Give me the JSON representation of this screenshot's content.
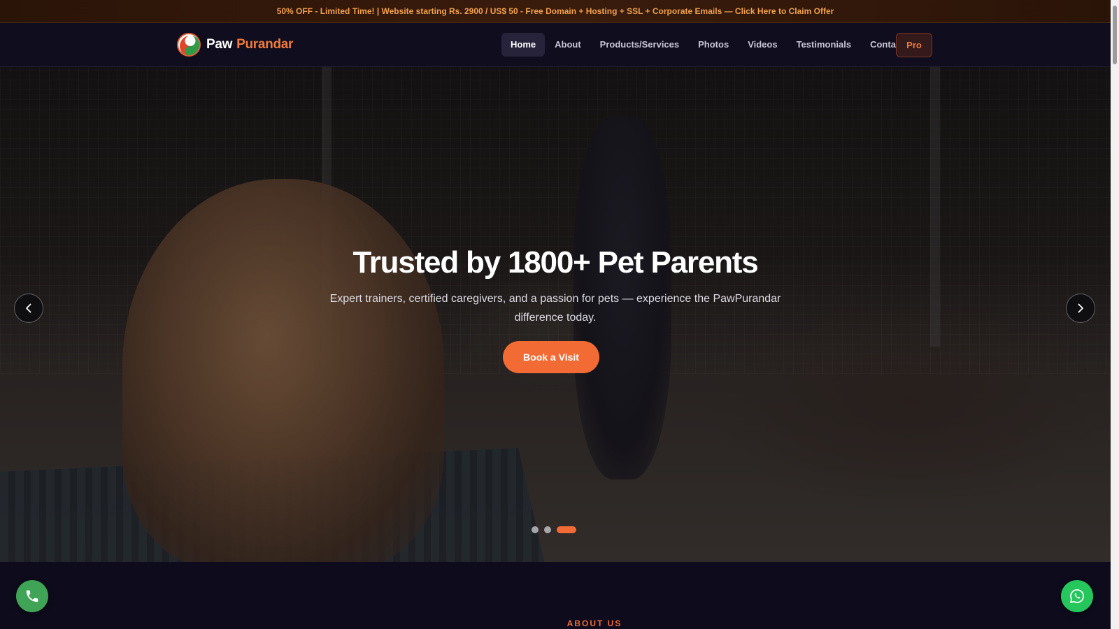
{
  "promo": {
    "text": "50% OFF - Limited Time! | Website starting Rs. 2900 / US$ 50 - Free Domain + Hosting + SSL + Corporate Emails — Click Here to Claim Offer"
  },
  "brand": {
    "name_part1": "Paw",
    "name_part2": "Purandar"
  },
  "nav": {
    "items": [
      {
        "label": "Home",
        "active": true
      },
      {
        "label": "About"
      },
      {
        "label": "Products/Services"
      },
      {
        "label": "Photos"
      },
      {
        "label": "Videos"
      },
      {
        "label": "Testimonials"
      },
      {
        "label": "Contact"
      }
    ],
    "pro_label": "Pro"
  },
  "hero": {
    "title": "Trusted by 1800+ Pet Parents",
    "subtitle": "Expert trainers, certified caregivers, and a passion for pets — experience the PawPurandar difference today.",
    "cta_label": "Book a Visit",
    "slides_total": 3,
    "active_slide": 3
  },
  "about": {
    "label": "ABOUT US"
  },
  "icons": {
    "prev": "chevron-left-icon",
    "next": "chevron-right-icon",
    "call": "phone-icon",
    "whatsapp": "whatsapp-icon"
  },
  "colors": {
    "accent": "#f26b35",
    "promo_text": "#f2a14d",
    "background": "#0e0c1c",
    "call_button": "#3fa456",
    "whatsapp_button": "#25c75c"
  }
}
